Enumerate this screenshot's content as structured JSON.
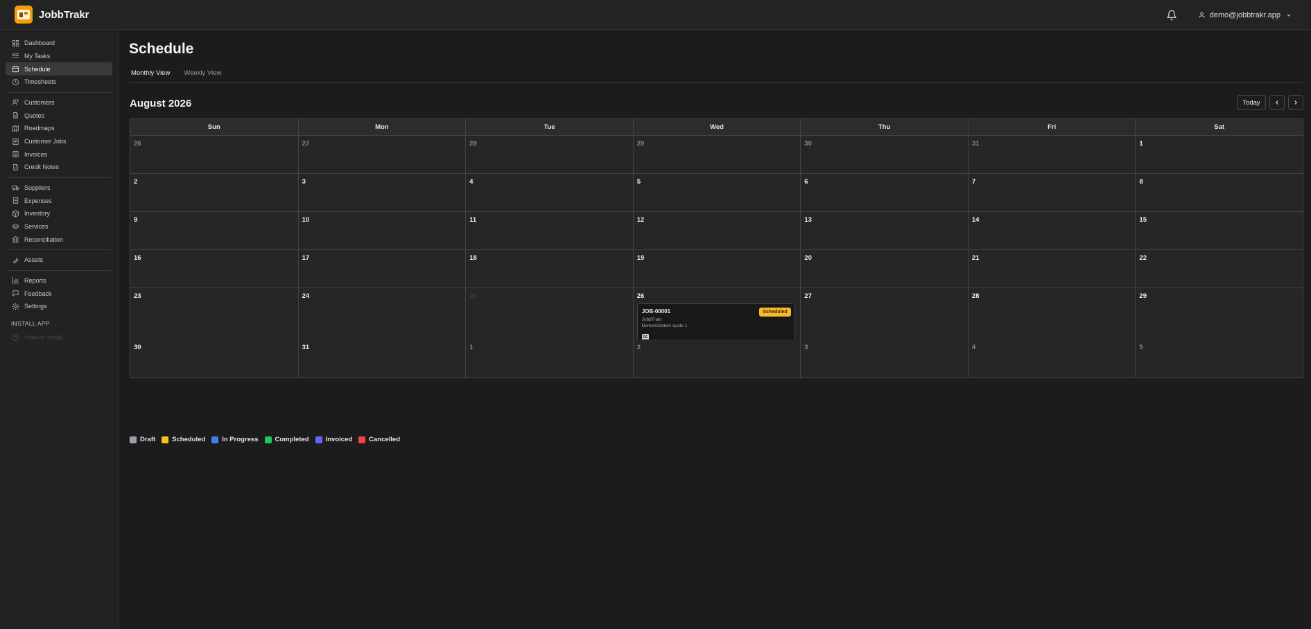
{
  "app": {
    "name": "JobbTrakr"
  },
  "header": {
    "user_email": "demo@jobbtrakr.app"
  },
  "sidebar": {
    "group1": [
      {
        "label": "Dashboard",
        "icon": "dashboard-icon"
      },
      {
        "label": "My Tasks",
        "icon": "tasks-icon"
      },
      {
        "label": "Schedule",
        "icon": "calendar-icon",
        "active": true
      },
      {
        "label": "Timesheets",
        "icon": "clock-icon"
      }
    ],
    "group2": [
      {
        "label": "Customers",
        "icon": "users-icon"
      },
      {
        "label": "Quotes",
        "icon": "document-icon"
      },
      {
        "label": "Roadmaps",
        "icon": "map-icon"
      },
      {
        "label": "Customer Jobs",
        "icon": "briefcase-icon"
      },
      {
        "label": "Invoices",
        "icon": "invoice-icon"
      },
      {
        "label": "Credit Notes",
        "icon": "credit-note-icon"
      }
    ],
    "group3": [
      {
        "label": "Suppliers",
        "icon": "truck-icon"
      },
      {
        "label": "Expenses",
        "icon": "receipt-icon"
      },
      {
        "label": "Inventory",
        "icon": "box-icon"
      },
      {
        "label": "Services",
        "icon": "layers-icon"
      },
      {
        "label": "Reconciliation",
        "icon": "bank-icon"
      }
    ],
    "group4": [
      {
        "label": "Assets",
        "icon": "wrench-icon"
      }
    ],
    "group5": [
      {
        "label": "Reports",
        "icon": "chart-icon"
      },
      {
        "label": "Feedback",
        "icon": "message-icon"
      },
      {
        "label": "Settings",
        "icon": "gear-icon"
      }
    ],
    "install_label": "INSTALL APP",
    "install_help": "How to Install"
  },
  "page": {
    "title": "Schedule",
    "tabs": [
      {
        "label": "Monthly View",
        "active": true
      },
      {
        "label": "Weekly View",
        "active": false
      }
    ],
    "month_title": "August 2026",
    "today_label": "Today"
  },
  "calendar": {
    "weekdays": [
      "Sun",
      "Mon",
      "Tue",
      "Wed",
      "Thu",
      "Fri",
      "Sat"
    ],
    "weeks": [
      [
        {
          "d": "26",
          "o": true
        },
        {
          "d": "27",
          "o": true
        },
        {
          "d": "28",
          "o": true
        },
        {
          "d": "29",
          "o": true
        },
        {
          "d": "30",
          "o": true
        },
        {
          "d": "31",
          "o": true
        },
        {
          "d": "1"
        }
      ],
      [
        {
          "d": "2"
        },
        {
          "d": "3"
        },
        {
          "d": "4"
        },
        {
          "d": "5"
        },
        {
          "d": "6"
        },
        {
          "d": "7"
        },
        {
          "d": "8"
        }
      ],
      [
        {
          "d": "9"
        },
        {
          "d": "10"
        },
        {
          "d": "11"
        },
        {
          "d": "12"
        },
        {
          "d": "13"
        },
        {
          "d": "14"
        },
        {
          "d": "15"
        }
      ],
      [
        {
          "d": "16"
        },
        {
          "d": "17"
        },
        {
          "d": "18"
        },
        {
          "d": "19"
        },
        {
          "d": "20"
        },
        {
          "d": "21"
        },
        {
          "d": "22"
        }
      ],
      [
        {
          "d": "23"
        },
        {
          "d": "24"
        },
        {
          "d": "25",
          "dim": true
        },
        {
          "d": "26",
          "event": true
        },
        {
          "d": "27"
        },
        {
          "d": "28"
        },
        {
          "d": "29"
        }
      ],
      [
        {
          "d": "30"
        },
        {
          "d": "31"
        },
        {
          "d": "1",
          "o": true
        },
        {
          "d": "2",
          "o": true
        },
        {
          "d": "3",
          "o": true
        },
        {
          "d": "4",
          "o": true
        },
        {
          "d": "5",
          "o": true
        }
      ]
    ],
    "event": {
      "id": "JOB-00001",
      "status": "Scheduled",
      "company": "JobbTrakr",
      "description": "Demonstration quote 1",
      "initials": "DE"
    }
  },
  "legend": [
    {
      "label": "Draft",
      "color": "#9ca3af"
    },
    {
      "label": "Scheduled",
      "color": "#fbbf24"
    },
    {
      "label": "In Progress",
      "color": "#3b82f6"
    },
    {
      "label": "Completed",
      "color": "#22c55e"
    },
    {
      "label": "Invoiced",
      "color": "#6366f1"
    },
    {
      "label": "Cancelled",
      "color": "#ef4444"
    }
  ]
}
